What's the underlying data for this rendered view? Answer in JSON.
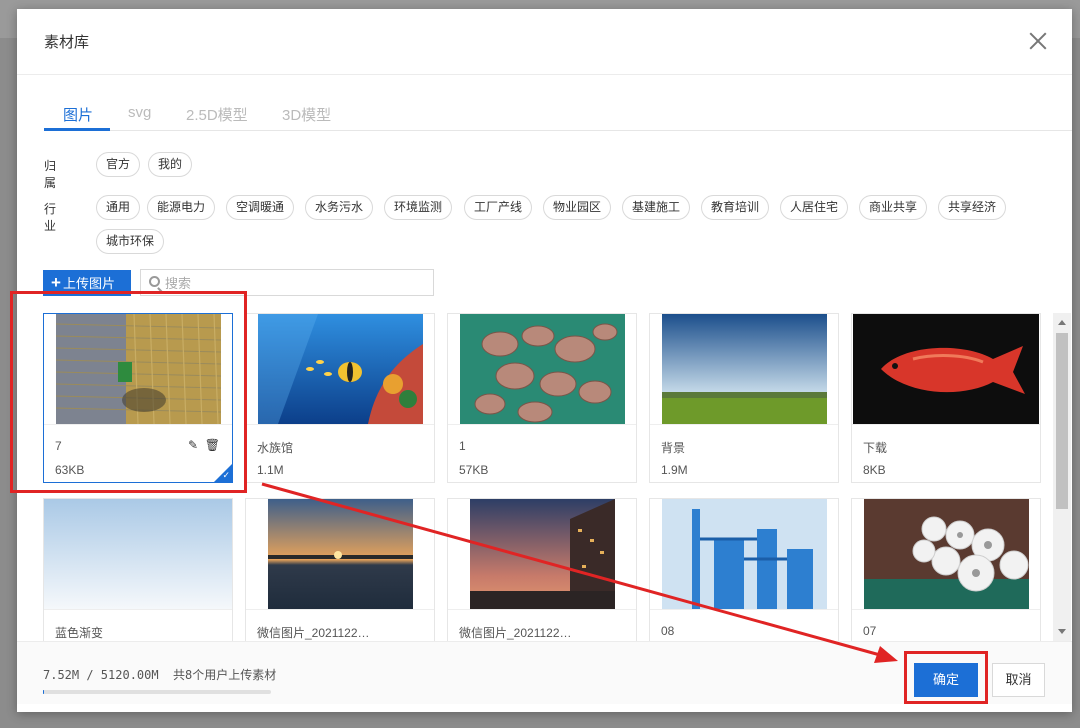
{
  "dialog": {
    "title": "素材库",
    "tabs": [
      {
        "label": "图片",
        "active": true
      },
      {
        "label": "svg",
        "active": false
      },
      {
        "label": "2.5D模型",
        "active": false
      },
      {
        "label": "3D模型",
        "active": false
      }
    ]
  },
  "filters": {
    "ownership_label": "归属",
    "ownership": [
      "官方",
      "我的"
    ],
    "industry_label": "行业",
    "industry": [
      "通用",
      "能源电力",
      "空调暖通",
      "水务污水",
      "环境监测",
      "工厂产线",
      "物业园区",
      "基建施工",
      "教育培训",
      "人居住宅",
      "商业共享",
      "共享经济",
      "城市环保"
    ]
  },
  "toolbar": {
    "upload_label": "上传图片",
    "upload_plus": "+",
    "search_placeholder": "搜索"
  },
  "materials": [
    {
      "name": "7",
      "size": "63KB",
      "selected": true,
      "image": "farm-harvester"
    },
    {
      "name": "水族馆",
      "size": "1.1M",
      "selected": false,
      "image": "aquarium"
    },
    {
      "name": "1",
      "size": "57KB",
      "selected": false,
      "image": "mushrooms"
    },
    {
      "name": "背景",
      "size": "1.9M",
      "selected": false,
      "image": "landscape"
    },
    {
      "name": "下载",
      "size": "8KB",
      "selected": false,
      "image": "arowana-fish"
    },
    {
      "name": "蓝色渐变",
      "size": "",
      "selected": false,
      "image": "blue-gradient"
    },
    {
      "name": "微信图片_2021122…",
      "size": "",
      "selected": false,
      "image": "sunset-lake"
    },
    {
      "name": "微信图片_2021122…",
      "size": "",
      "selected": false,
      "image": "building-dusk"
    },
    {
      "name": "08",
      "size": "",
      "selected": false,
      "image": "industrial-plant"
    },
    {
      "name": "07",
      "size": "",
      "selected": false,
      "image": "yarn-spools"
    }
  ],
  "footer": {
    "usage": "7.52M / 5120.00M",
    "note": "共8个用户上传素材",
    "usage_fraction": 0.0015,
    "ok_label": "确定",
    "cancel_label": "取消"
  },
  "colors": {
    "accent": "#1c6fd6",
    "annotation": "#e02424"
  }
}
